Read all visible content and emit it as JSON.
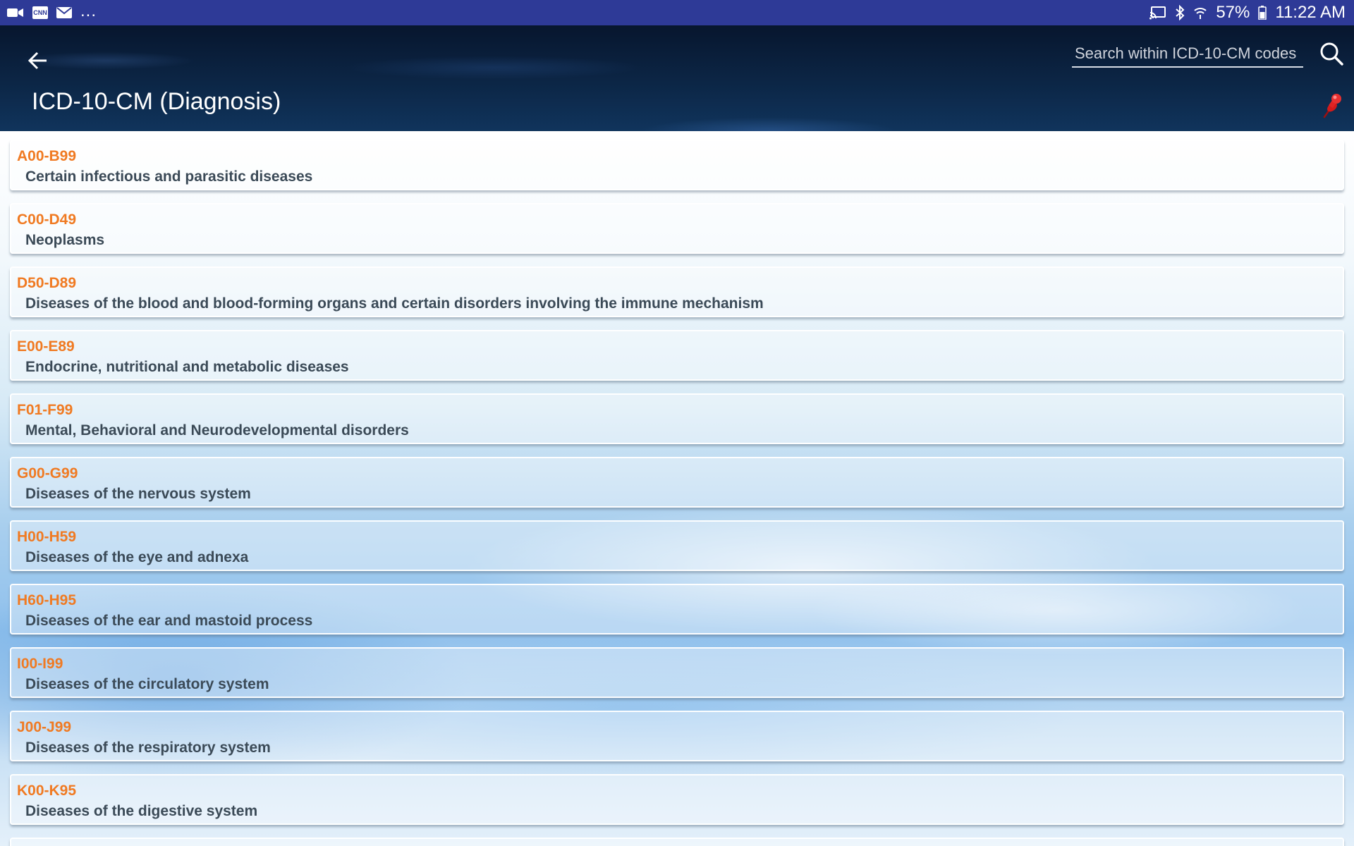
{
  "status_bar": {
    "left_icons": [
      "video-icon",
      "cnn-icon",
      "mail-icon"
    ],
    "more_text": "...",
    "battery_text": "57%",
    "time_text": "11:22 AM"
  },
  "header": {
    "title": "ICD-10-CM (Diagnosis)",
    "search_placeholder": "Search within ICD-10-CM codes",
    "search_value": ""
  },
  "colors": {
    "status_bar": "#2e3a97",
    "code_text": "#f07a22",
    "desc_text": "#3b4a57"
  },
  "list": {
    "items": [
      {
        "code": "A00-B99",
        "description": "Certain infectious and parasitic diseases"
      },
      {
        "code": "C00-D49",
        "description": "Neoplasms"
      },
      {
        "code": "D50-D89",
        "description": "Diseases of the blood and blood-forming organs and certain disorders involving the immune mechanism"
      },
      {
        "code": "E00-E89",
        "description": "Endocrine, nutritional and metabolic diseases"
      },
      {
        "code": "F01-F99",
        "description": "Mental, Behavioral and Neurodevelopmental disorders"
      },
      {
        "code": "G00-G99",
        "description": "Diseases of the nervous system"
      },
      {
        "code": "H00-H59",
        "description": "Diseases of the eye and adnexa"
      },
      {
        "code": "H60-H95",
        "description": "Diseases of the ear and mastoid process"
      },
      {
        "code": "I00-I99",
        "description": "Diseases of the circulatory system"
      },
      {
        "code": "J00-J99",
        "description": "Diseases of the respiratory system"
      },
      {
        "code": "K00-K95",
        "description": "Diseases of the digestive system"
      }
    ]
  }
}
